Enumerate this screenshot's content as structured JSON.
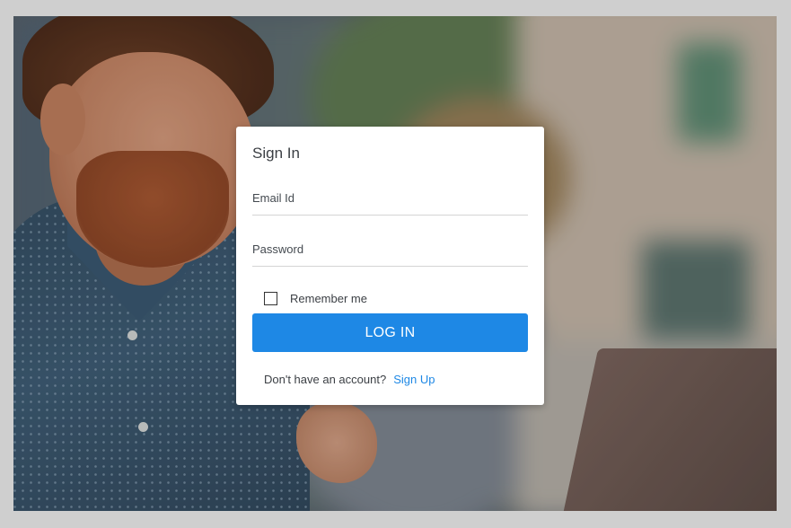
{
  "signin": {
    "title": "Sign In",
    "email_placeholder": "Email Id",
    "password_placeholder": "Password",
    "remember_label": "Remember me",
    "remember_checked": false,
    "login_button": "LOG IN",
    "no_account_text": "Don't have an account?",
    "signup_link": "Sign Up"
  },
  "colors": {
    "accent": "#1e88e5",
    "card_bg": "#ffffff",
    "page_bg": "#cfcfcf"
  }
}
